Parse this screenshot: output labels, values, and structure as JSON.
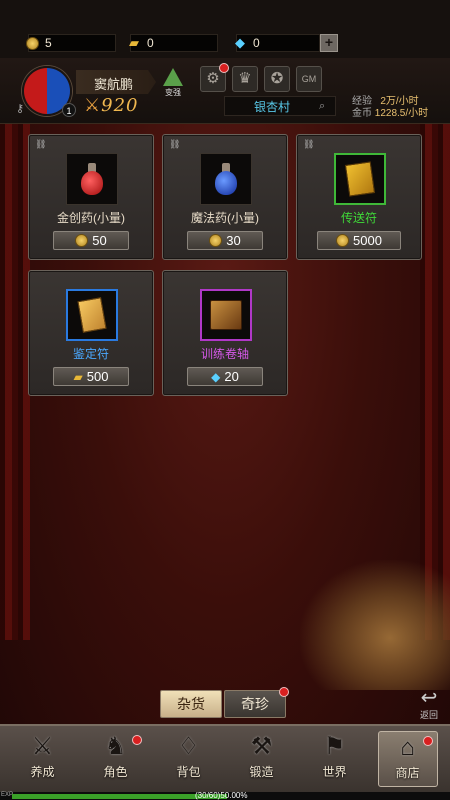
{
  "resources": {
    "gold": "5",
    "ingot": "0",
    "gem": "0",
    "add_label": "+"
  },
  "player": {
    "name": "窦航鹏",
    "level": "1",
    "power": "920",
    "upgrade_label": "变强"
  },
  "header": {
    "location": "银杏村",
    "exp_label": "经验",
    "exp_value": "2万/小时",
    "gold_label": "金币",
    "gold_value": "1228.5/小时",
    "gm_label": "GM"
  },
  "shop_items": [
    {
      "name": "金创药(小量)",
      "price": "50",
      "currency": "gold-coin",
      "rarity_color": "#ffffff"
    },
    {
      "name": "魔法药(小量)",
      "price": "30",
      "currency": "gold-coin",
      "rarity_color": "#ffffff"
    },
    {
      "name": "传送符",
      "price": "5000",
      "currency": "gold-coin",
      "rarity_color": "#3fd838"
    },
    {
      "name": "鉴定符",
      "price": "500",
      "currency": "gold-ingot",
      "rarity_color": "#4aa8ff"
    },
    {
      "name": "训练卷轴",
      "price": "20",
      "currency": "diamond",
      "rarity_color": "#d458e8"
    }
  ],
  "tabs": {
    "general": "杂货",
    "rare": "奇珍"
  },
  "back_label": "返回",
  "nav": [
    {
      "label": "养成"
    },
    {
      "label": "角色"
    },
    {
      "label": "背包"
    },
    {
      "label": "锻造"
    },
    {
      "label": "世界"
    },
    {
      "label": "商店"
    }
  ],
  "exp_bar": {
    "tag": "EXP",
    "text": "(30/60)50.00%",
    "progress_percent": 50
  },
  "colors": {
    "background": "#3a0e0a",
    "accent_gold": "#f0b850",
    "location_cyan": "#58c8e8",
    "badge_red": "#d82020"
  }
}
